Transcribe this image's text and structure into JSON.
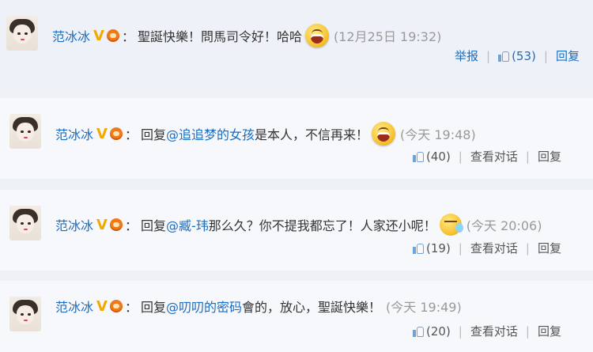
{
  "comments": [
    {
      "user": "范冰冰",
      "badge": "V",
      "colon": "：",
      "text": "聖誕快樂！問馬司令好！哈哈",
      "mention": "",
      "emoji": "laugh-emoji",
      "time": "(12月25日 19:32)",
      "actions": {
        "report": "举报",
        "likes": "(53)",
        "reply": "回复"
      }
    },
    {
      "user": "范冰冰",
      "badge": "V",
      "colon": "：",
      "reply_prefix": "回复",
      "mention": "@追追梦的女孩",
      "text": "是本人，不信再来！",
      "emoji": "laugh-emoji",
      "time": "(今天 19:48)",
      "actions": {
        "likes": "(40)",
        "view_dialog": "查看对话",
        "reply": "回复"
      }
    },
    {
      "user": "范冰冰",
      "badge": "V",
      "colon": "：",
      "reply_prefix": "回复",
      "mention": "@臧-玮",
      "text": "那么久？你不提我都忘了！人家还小呢！",
      "emoji": "sleepy-emoji",
      "time": "(今天 20:06)",
      "actions": {
        "likes": "(19)",
        "view_dialog": "查看对话",
        "reply": "回复"
      }
    },
    {
      "user": "范冰冰",
      "badge": "V",
      "colon": "：",
      "reply_prefix": "回复",
      "mention": "@叨叨的密码",
      "text": "會的，放心，聖誕快樂！",
      "emoji": "",
      "time": "(今天 19:49)",
      "actions": {
        "likes": "(20)",
        "view_dialog": "查看对话",
        "reply": "回复"
      }
    }
  ],
  "colors": {
    "link": "#1a6dc1",
    "badge": "#f2a900",
    "time": "#999999"
  }
}
